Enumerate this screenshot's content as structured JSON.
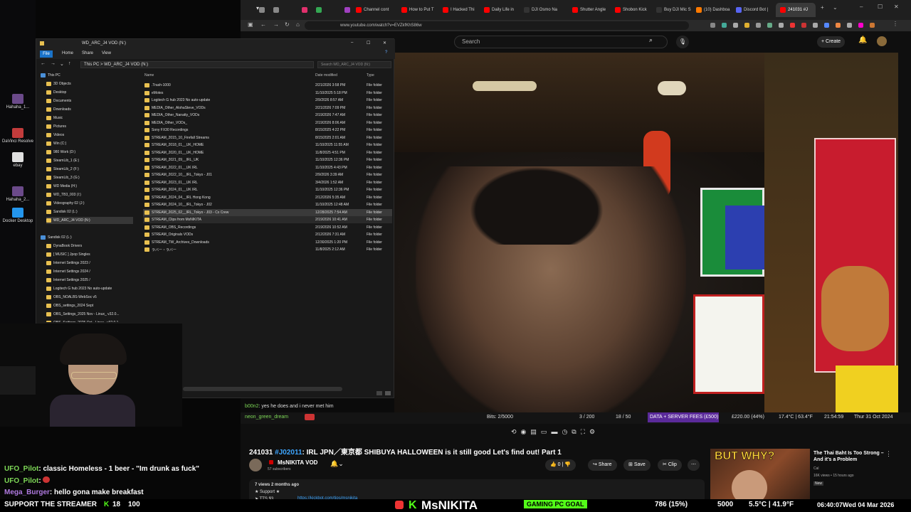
{
  "desktop": {
    "icons": [
      {
        "label": "Hahaha_1...",
        "color": "#6b4a8a"
      },
      {
        "label": "DaVinci Resolve",
        "color": "#c23c3c"
      },
      {
        "label": "ebay",
        "color": "#e0e0e0"
      },
      {
        "label": "Hahaha_2...",
        "color": "#6b4a8a"
      },
      {
        "label": "Docker Desktop",
        "color": "#2496ed"
      }
    ]
  },
  "browser": {
    "tabs": [
      {
        "label": "",
        "color": "#888"
      },
      {
        "label": "",
        "color": "#888"
      },
      {
        "label": "",
        "color": "#e1306c"
      },
      {
        "label": "",
        "color": "#34a853"
      },
      {
        "label": "",
        "color": "#a040c0"
      },
      {
        "label": "Channel cont",
        "color": "#ff0000"
      },
      {
        "label": "How to Put T",
        "color": "#ff0000"
      },
      {
        "label": "I Hacked Thi",
        "color": "#ff0000"
      },
      {
        "label": "Daily Life in",
        "color": "#ff0000"
      },
      {
        "label": "DJI Osmo Na",
        "color": "#333"
      },
      {
        "label": "Shutter Angle",
        "color": "#ff0000"
      },
      {
        "label": "Shobon Kick",
        "color": "#ff0000"
      },
      {
        "label": "Buy DJI Mic S",
        "color": "#333"
      },
      {
        "label": "(10) Dashboa",
        "color": "#ff7a00"
      },
      {
        "label": "Discord Bot |",
        "color": "#5865f2"
      },
      {
        "label": "241031 #J",
        "color": "#ff0000"
      }
    ],
    "url": "www.youtube.com/watch?v=EVZkfKhS86w"
  },
  "youtube": {
    "search_placeholder": "Search",
    "create_label": "Create",
    "video_title_tag": "#J02011",
    "video_title_prefix": "241031",
    "video_title_rest": ": IRL JPN／東京都 SHIBUYA HALLOWEEN is it still good Let's find out! Part 1",
    "channel_name": "MsNIKITA VOD",
    "subscribers": "57 subscribers",
    "likes": "0",
    "share_label": "Share",
    "save_label": "Save",
    "clip_label": "Clip",
    "desc_meta": "7 views  2 months ago",
    "desc_support": "★ Support ★",
    "desc_tts_label": "TTS $3",
    "desc_tts_link": "https://kickbot.com/tips/msnikita",
    "rec_title": "The Thai Baht Is Too Strong – And it's a Problem",
    "rec_channel": "Cal",
    "rec_meta": "16K views • 15 hours ago",
    "rec_badge": "New",
    "rec_thumb_text": "BUT WHY?"
  },
  "stream_overlay": {
    "chat": [
      {
        "user": "b00n2",
        "text": "yes he does and i never met him"
      },
      {
        "user": "neon_green_dream",
        "text": ""
      }
    ],
    "bits": "Bits: 2/5000",
    "counter_a": "3 / 200",
    "counter_b": "18 / 50",
    "fees": "DATA + SERVER FEES (£500)",
    "fees_amount": "£220.00 (44%)",
    "temp": "17.4°C | 63.4°F",
    "time": "21:54:59",
    "date": "Thur 31 Oct 2024"
  },
  "explorer": {
    "title": "WD_ARC_J4 VOD (N:)",
    "ribbon": [
      "File",
      "Home",
      "Share",
      "View"
    ],
    "breadcrumb": "This PC  >  WD_ARC_J4 VOD (N:)",
    "search_placeholder": "Search WD_ARC_J4 VOD (N:)",
    "columns": {
      "name": "Name",
      "date": "Date modified",
      "type": "Type"
    },
    "nav": [
      {
        "label": "This PC",
        "indent": 0
      },
      {
        "label": "3D Objects",
        "indent": 1
      },
      {
        "label": "Desktop",
        "indent": 1
      },
      {
        "label": "Documents",
        "indent": 1
      },
      {
        "label": "Downloads",
        "indent": 1
      },
      {
        "label": "Music",
        "indent": 1
      },
      {
        "label": "Pictures",
        "indent": 1
      },
      {
        "label": "Videos",
        "indent": 1
      },
      {
        "label": "Win (C:)",
        "indent": 1
      },
      {
        "label": "980 Work (D:)",
        "indent": 1
      },
      {
        "label": "SteamLib_1 (E:)",
        "indent": 1
      },
      {
        "label": "SteamLib_2 (F:)",
        "indent": 1
      },
      {
        "label": "SteamLib_3 (G:)",
        "indent": 1
      },
      {
        "label": "WD Media (H:)",
        "indent": 1
      },
      {
        "label": "WD_TB3_003 (I:)",
        "indent": 1
      },
      {
        "label": "Videography 02 (J:)",
        "indent": 1
      },
      {
        "label": "Sandisk 02 (L:)",
        "indent": 1
      },
      {
        "label": "WD_ARC_J4 VOD (N:)",
        "indent": 1,
        "selected": true
      },
      {
        "label": "",
        "indent": 0
      },
      {
        "label": "Sandisk 02 (L:)",
        "indent": 0
      },
      {
        "label": "DynaBook Drivers",
        "indent": 1
      },
      {
        "label": "[ MUSIC ] Jpop Singles",
        "indent": 1
      },
      {
        "label": "Internet Settings 2023 /",
        "indent": 1
      },
      {
        "label": "Internet Settings 2024 /",
        "indent": 1
      },
      {
        "label": "Internet Settings 2025 /",
        "indent": 1
      },
      {
        "label": "Logitech G hub 2023 No auto-update",
        "indent": 1
      },
      {
        "label": "OBS_NOALBS-WebSoc v5",
        "indent": 1
      },
      {
        "label": "OBS_settings_2024 Sept",
        "indent": 1
      },
      {
        "label": "OBS_Settings_2025 Nov - Linux_ v32.0...",
        "indent": 1
      },
      {
        "label": "OBS_Settings_2025 Oct - Linux_ v32.0.1",
        "indent": 1
      }
    ],
    "files": [
      {
        "name": ".Trash-1000",
        "date": "2/21/2026 3:58 PM",
        "type": "File folder"
      },
      {
        "name": "eMotes",
        "date": "11/10/2025 5:18 PM",
        "type": "File folder"
      },
      {
        "name": "Logitech G hub 2023 No auto-update",
        "date": "2/9/2026 8:57 AM",
        "type": "File folder"
      },
      {
        "name": "MEDIA_Other_AlohaSteve_VODs",
        "date": "2/21/2026 7:09 PM",
        "type": "File folder"
      },
      {
        "name": "MEDIA_Other_Nanatty_VODs",
        "date": "2/19/2026 7:47 AM",
        "type": "File folder"
      },
      {
        "name": "MEDIA_Other_VODs_",
        "date": "2/19/2026 8:06 AM",
        "type": "File folder"
      },
      {
        "name": "Sony FX30 Recordings",
        "date": "8/15/2025 4:22 PM",
        "type": "File folder"
      },
      {
        "name": "STREAM_2015_10_Firefall Streams",
        "date": "8/15/2025 2:01 AM",
        "type": "File folder"
      },
      {
        "name": "STREAM_2018_01__UK_HOME",
        "date": "11/10/2025 11:55 AM",
        "type": "File folder"
      },
      {
        "name": "STREAM_2020_01__UK_HOME",
        "date": "11/8/2025 4:51 PM",
        "type": "File folder"
      },
      {
        "name": "STREAM_2021_09__IRL_UK",
        "date": "11/10/2025 12:36 PM",
        "type": "File folder"
      },
      {
        "name": "STREAM_2022_01__UK IRL",
        "date": "11/10/2025 4:43 PM",
        "type": "File folder"
      },
      {
        "name": "STREAM_2022_10__IRL_Tokyo - J01",
        "date": "2/9/2026 3:39 AM",
        "type": "File folder"
      },
      {
        "name": "STREAM_2023_01__UK IRL",
        "date": "3/4/2026 1:52 AM",
        "type": "File folder"
      },
      {
        "name": "STREAM_2024_01__UK IRL",
        "date": "11/10/2025 12:36 PM",
        "type": "File folder"
      },
      {
        "name": "STREAM_2024_04__IRL Hong Kong",
        "date": "2/12/2026 5:35 AM",
        "type": "File folder"
      },
      {
        "name": "STREAM_2024_10__IRL_Tokyo - J02",
        "date": "11/10/2025 12:48 AM",
        "type": "File folder"
      },
      {
        "name": "STREAM_2025_02__IRL_Tokyo - J03 - Cx Crew",
        "date": "12/28/2025 7:54 AM",
        "type": "File folder",
        "highlight": "selected"
      },
      {
        "name": "STREAM_Clips from MsNIKITA",
        "date": "2/19/2026 10:41 AM",
        "type": "File folder",
        "highlight": "hover"
      },
      {
        "name": "STREAM_OBS_Recordings",
        "date": "2/19/2026 10:52 AM",
        "type": "File folder"
      },
      {
        "name": "STREAM_Originals VODs",
        "date": "2/12/2026 7:31 AM",
        "type": "File folder"
      },
      {
        "name": "STREAM_TW_Archives_Downloads",
        "date": "12/30/2025 1:20 PM",
        "type": "File folder"
      },
      {
        "name": "ラバー・ラバー",
        "date": "11/8/2025 2:12 AM",
        "type": "File folder"
      }
    ]
  },
  "left_chat": [
    {
      "user": "UFO_Pilot",
      "text": "classic Homeless - 1 beer - \"Im drunk as fuck\""
    },
    {
      "user": "UFO_Pilot",
      "text": ""
    },
    {
      "user": "Mega_Burger",
      "text": "hello gona make breakfast"
    }
  ],
  "bottom_bar": {
    "support": "SUPPORT THE STREAMER",
    "kick_count": "18",
    "hundred": "100",
    "brand": "MsNIKITA",
    "goal_label": "GAMING PC GOAL",
    "goal_value": "786 (15%)",
    "goal_target": "5000",
    "temp": "5.5°C | 41.9°F",
    "time": "06:40:07",
    "date": "Wed 04 Mar 2026"
  },
  "colors": {
    "accent_green": "#53fc18",
    "youtube_red": "#ff0000",
    "fee_purple": "#9146ff",
    "link_blue": "#3ea6ff"
  }
}
